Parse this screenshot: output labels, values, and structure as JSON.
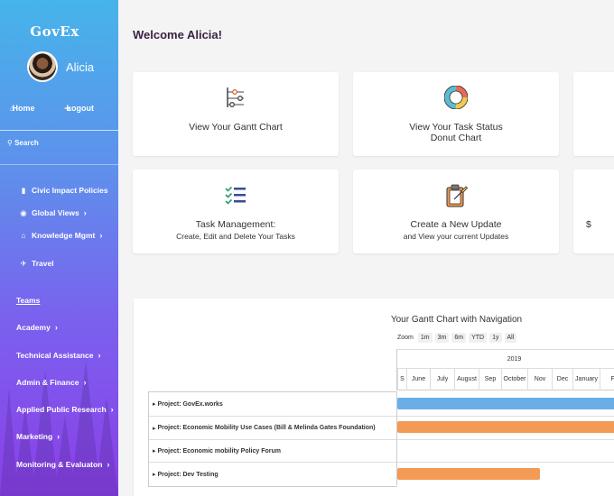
{
  "app": {
    "brand": "GovEx",
    "user": "Alicia"
  },
  "sidebar": {
    "home": "Home",
    "logout": "Logout",
    "search": "Search",
    "nav": [
      {
        "label": "Civic Impact Policies",
        "icon": "book-icon"
      },
      {
        "label": "Global Views",
        "icon": "globe-icon",
        "chevron": true
      },
      {
        "label": "Knowledge Mgmt",
        "icon": "institution-icon",
        "chevron": true
      },
      {
        "label": "Travel",
        "icon": "plane-icon"
      }
    ],
    "sections": [
      {
        "label": "Teams",
        "underline": true
      },
      {
        "label": "Academy"
      },
      {
        "label": "Technical Assistance"
      },
      {
        "label": "Admin & Finance"
      },
      {
        "label": "Applied Public Research"
      },
      {
        "label": "Marketing"
      },
      {
        "label": "Monitoring & Evaluaton"
      }
    ]
  },
  "main": {
    "welcome": "Welcome Alicia!",
    "cards": [
      {
        "line1": "View Your Gantt Chart",
        "line2": "",
        "icon": "gantt-chart-icon"
      },
      {
        "line1": "View Your Task Status",
        "line2": "Donut Chart",
        "icon": "donut-chart-icon"
      },
      {
        "line1": "Task Management:",
        "line2": "Create, Edit and Delete Your Tasks",
        "icon": "checklist-icon"
      },
      {
        "line1": "Create a New Update",
        "line2": "and View your current Updates",
        "icon": "clipboard-pencil-icon"
      }
    ],
    "partial_card_text": "$"
  },
  "gantt": {
    "title": "Your Gantt Chart with Navigation",
    "zoom_label": "Zoom",
    "zoom_options": [
      "1m",
      "3m",
      "6m",
      "YTD",
      "1y",
      "All"
    ],
    "year": "2019",
    "months": [
      "S",
      "June",
      "July",
      "August",
      "Sep",
      "October",
      "Nov",
      "Dec",
      "January",
      "Feb"
    ],
    "rows": [
      "Project: GovEx.works",
      "Project: Economic Mobility Use Cases (Bill & Melinda Gates Foundation)",
      "Project: Economic mobility Policy Forum",
      "Project: Dev Testing"
    ],
    "colors": {
      "blue": "#6aaee8",
      "orange": "#f39a55"
    }
  }
}
